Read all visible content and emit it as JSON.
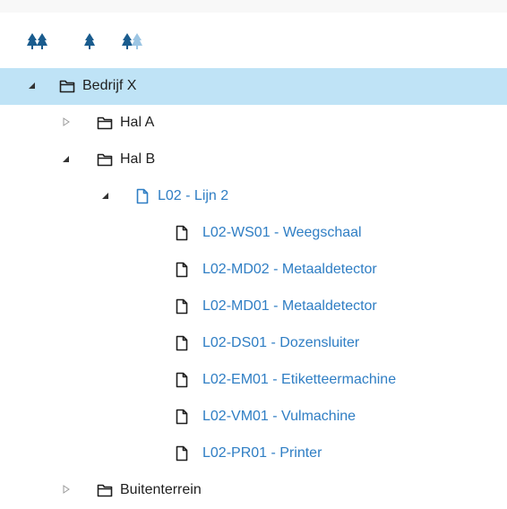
{
  "colors": {
    "accent": "#2f7ec4",
    "selected_bg": "#bfe3f6",
    "text": "#1f1f1f",
    "icon_dark": "#1a5c8e",
    "icon_light": "#9cc5e3",
    "toggle_collapsed": "#9a9a9a",
    "toggle_expanded": "#333333"
  },
  "toolbar": {
    "buttons": [
      {
        "name": "expand-all-button",
        "icon": "trees-icon"
      },
      {
        "name": "expand-level-button",
        "icon": "tree-icon"
      },
      {
        "name": "collapse-all-button",
        "icon": "trees-faded-icon"
      }
    ]
  },
  "tree": {
    "root": {
      "label": "Bedrijf X",
      "expanded": true,
      "selected": true,
      "type": "folder"
    },
    "hal_a": {
      "label": "Hal A",
      "expanded": false,
      "type": "folder"
    },
    "hal_b": {
      "label": "Hal B",
      "expanded": true,
      "type": "folder"
    },
    "lijn_2": {
      "label": "L02 - Lijn 2",
      "expanded": true,
      "type": "file"
    },
    "machines": [
      {
        "label": "L02-WS01 - Weegschaal"
      },
      {
        "label": "L02-MD02 - Metaaldetector"
      },
      {
        "label": "L02-MD01 - Metaaldetector"
      },
      {
        "label": "L02-DS01 - Dozensluiter"
      },
      {
        "label": "L02-EM01 - Etiketteermachine"
      },
      {
        "label": "L02-VM01 - Vulmachine"
      },
      {
        "label": "L02-PR01 - Printer"
      }
    ],
    "buitenterrein": {
      "label": "Buitenterrein",
      "expanded": false,
      "type": "folder"
    }
  }
}
